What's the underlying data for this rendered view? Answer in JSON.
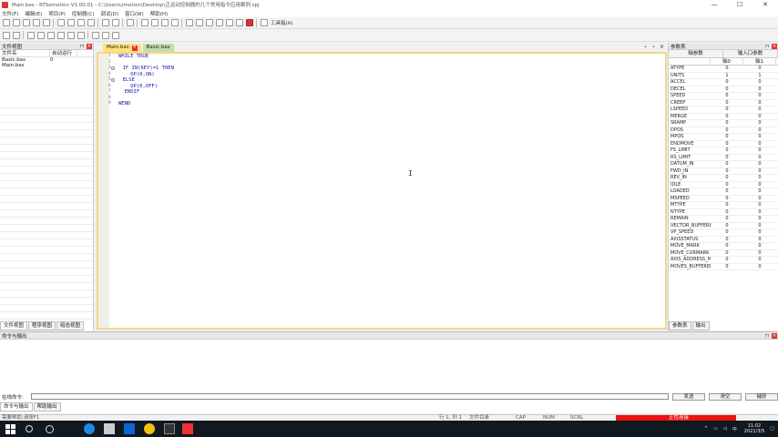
{
  "window": {
    "title": "Main.bas - RTSemotion V1.00.01 - C:\\Users\\zmotion\\Desktop\\正运动控制器的几个常用指令应用案例.zpj",
    "controls": [
      "—",
      "☐",
      "✕"
    ]
  },
  "menu": [
    "文件(F)",
    "编辑(E)",
    "项目(P)",
    "控制器(C)",
    "调试(D)",
    "窗口(W)",
    "帮助(H)"
  ],
  "toolbar1": {
    "buttons": [
      "new",
      "open",
      "save",
      "saveall",
      "print",
      "cut",
      "copy",
      "paste",
      "undo",
      "redo",
      "find",
      "replace",
      "download",
      "build",
      "run",
      "pause",
      "step",
      "stepin",
      "stepout",
      "stop"
    ],
    "label": "工具箱(A)"
  },
  "toolbar2": {
    "buttons": [
      "t1",
      "t2",
      "t3",
      "t4",
      "t5",
      "t6",
      "t7",
      "t8",
      "t9",
      "t10",
      "t11",
      "t12"
    ]
  },
  "file_view": {
    "title": "文件视图",
    "columns": [
      "文件名",
      "自动运行"
    ],
    "rows": [
      {
        "name": "Basic.bas",
        "auto": "0"
      },
      {
        "name": "Main.bas",
        "auto": ""
      }
    ],
    "tabs": [
      "文件视图",
      "程序视图",
      "组态视图"
    ]
  },
  "editor": {
    "tabs": [
      {
        "label": "Main.bas",
        "active": true
      },
      {
        "label": "Basic.bas",
        "active": false
      }
    ],
    "lines": [
      {
        "num": "1",
        "fold": false,
        "text": "WHILE TRUE"
      },
      {
        "num": "2",
        "fold": false,
        "text": ""
      },
      {
        "num": "3",
        "fold": true,
        "text": "  IF IN(KEY)=1 THEN"
      },
      {
        "num": "4",
        "fold": false,
        "text": "    OP(0,ON)"
      },
      {
        "num": "5",
        "fold": true,
        "text": "  ELSE"
      },
      {
        "num": "6",
        "fold": false,
        "text": "    OP(0,OFF)"
      },
      {
        "num": "7",
        "fold": false,
        "text": "  ENDIF"
      },
      {
        "num": "8",
        "fold": false,
        "text": ""
      },
      {
        "num": "9",
        "fold": false,
        "text": "WEND"
      }
    ],
    "cursor_glyph": "I"
  },
  "axis_params": {
    "title": "参数表",
    "tabs": [
      "轴参数",
      "输入口参数"
    ],
    "columns": [
      "",
      "轴0",
      "轴1"
    ],
    "rows": [
      [
        "ATYPE",
        "0",
        "0"
      ],
      [
        "UNITS",
        "1",
        "1"
      ],
      [
        "ACCEL",
        "0",
        "0"
      ],
      [
        "DECEL",
        "0",
        "0"
      ],
      [
        "SPEED",
        "0",
        "0"
      ],
      [
        "CREEP",
        "0",
        "0"
      ],
      [
        "LSPEED",
        "0",
        "0"
      ],
      [
        "MERGE",
        "0",
        "0"
      ],
      [
        "SRAMP",
        "0",
        "0"
      ],
      [
        "DPOS",
        "0",
        "0"
      ],
      [
        "MPOS",
        "0",
        "0"
      ],
      [
        "ENDMOVE",
        "0",
        "0"
      ],
      [
        "FS_LIMIT",
        "0",
        "0"
      ],
      [
        "RS_LIMIT",
        "0",
        "0"
      ],
      [
        "DATUM_IN",
        "0",
        "0"
      ],
      [
        "FWD_IN",
        "0",
        "0"
      ],
      [
        "REV_IN",
        "0",
        "0"
      ],
      [
        "IDLE",
        "0",
        "0"
      ],
      [
        "LOADED",
        "0",
        "0"
      ],
      [
        "MSPEED",
        "0",
        "0"
      ],
      [
        "MTYPE",
        "0",
        "0"
      ],
      [
        "NTYPE",
        "0",
        "0"
      ],
      [
        "REMAIN",
        "0",
        "0"
      ],
      [
        "VECTOR_BUFFERED",
        "0",
        "0"
      ],
      [
        "VP_SPEED",
        "0",
        "0"
      ],
      [
        "AXISSTATUS",
        "0",
        "0"
      ],
      [
        "MOVE_MARK",
        "0",
        "0"
      ],
      [
        "MOVE_CURMARK",
        "0",
        "0"
      ],
      [
        "AXIS_ADDRESS_MODE",
        "0",
        "0"
      ],
      [
        "MOVES_BUFFERED",
        "0",
        "0"
      ]
    ],
    "bottom_tabs": [
      "参数表",
      "输出"
    ]
  },
  "output": {
    "title": "命令与输出",
    "cmd_label": "在线命令:",
    "buttons": [
      "发送",
      "清空",
      "捕获"
    ],
    "tabs": [
      "命令与输出",
      "帮助输出"
    ]
  },
  "status": {
    "left": "需要帮助,请按F1",
    "pos": "行 1, 列 1",
    "flag1": "文件目录",
    "flag2": "CAP",
    "flag3": "NUM",
    "flag4": "SCRL",
    "conn": "正在连接"
  },
  "tray": {
    "time": "11:02",
    "date": "2021/3/5"
  }
}
